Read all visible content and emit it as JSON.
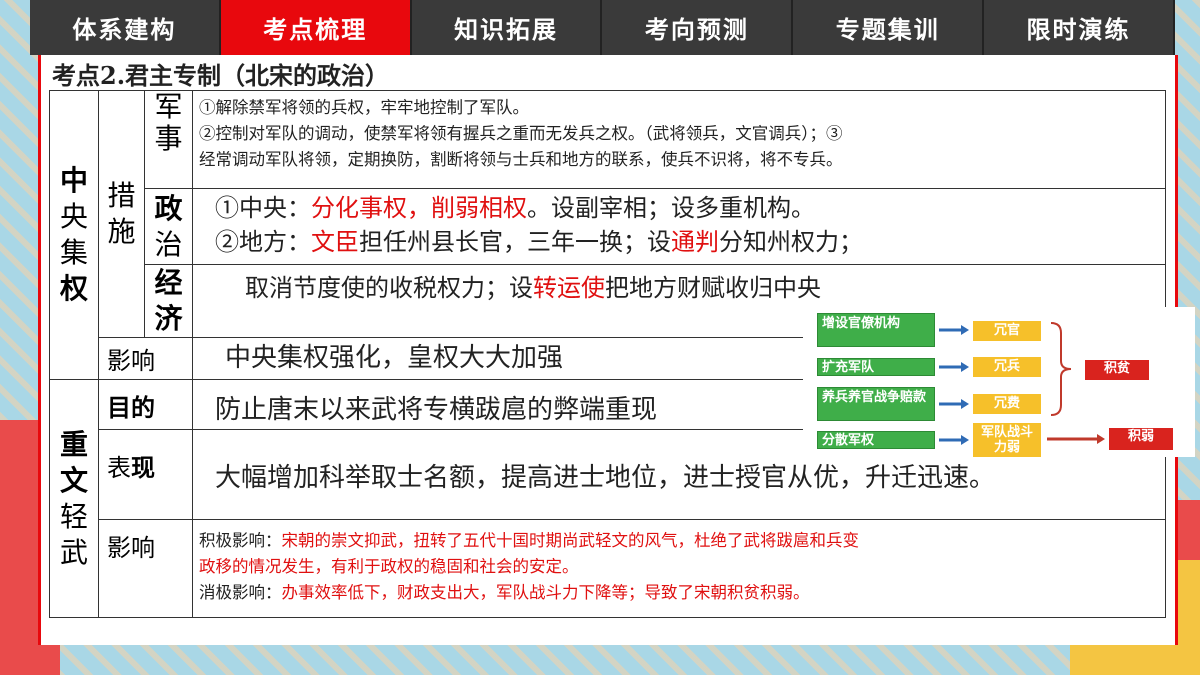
{
  "nav": {
    "tabs": [
      {
        "label": "体系建构",
        "active": false
      },
      {
        "label": "考点梳理",
        "active": true
      },
      {
        "label": "知识拓展",
        "active": false
      },
      {
        "label": "考向预测",
        "active": false
      },
      {
        "label": "专题集训",
        "active": false
      },
      {
        "label": "限时演练",
        "active": false
      }
    ]
  },
  "heading": "考点2.君主专制（北宋的政治）",
  "table": {
    "centralization": {
      "label_chars": [
        "中",
        "央",
        "集",
        "权"
      ],
      "measures_label_chars": [
        "措",
        "施"
      ],
      "military": {
        "label_chars": [
          "军",
          "事"
        ],
        "lines": [
          "①解除禁军将领的兵权，牢牢地控制了军队。",
          "②控制对军队的调动，使禁军将领有握兵之重而无发兵之权。（武将领兵，文官调兵）；③",
          "经常调动军队将领，定期换防，割断将领与士兵和地方的联系，使兵不识将，将不专兵。"
        ]
      },
      "politics": {
        "label_chars": [
          "政",
          "治"
        ],
        "line1": {
          "prefix": "①中央：",
          "red": "分化事权，削弱相权",
          "suffix": "。设副宰相；设多重机构。"
        },
        "line2": {
          "prefix": "②地方：",
          "red1": "文臣",
          "mid": "担任州县长官，三年一换；设",
          "red2": "通判",
          "suffix": "分知州权力；"
        }
      },
      "economy": {
        "label_chars": [
          "经",
          "济"
        ],
        "text_prefix": "取消节度使的收税权力；设",
        "text_red": "转运使",
        "text_suffix": "把地方财赋收归中央"
      },
      "impact": {
        "label": "影响",
        "text": "中央集权强化，皇权大大加强"
      }
    },
    "civil_over_military": {
      "label_chars": [
        "重",
        "文",
        "轻",
        "武"
      ],
      "purpose": {
        "label": "目的",
        "text": "防止唐末以来武将专横跋扈的弊端重现"
      },
      "manifestation": {
        "label_a": "表",
        "label_b": "现",
        "text": "大幅增加科举取士名额，提高进士地位，进士授官从优，升迁迅速。"
      },
      "impact": {
        "label": "影响",
        "positive_label": "积极影响：",
        "positive_text_1": "宋朝的崇文抑武，扭转了五代十国时期尚武轻文的风气，杜绝了武将跋扈和兵变",
        "positive_text_2": "政移的情况发生，有利于政权的稳固和社会的安定。",
        "negative_label": "消极影响：",
        "negative_text": "办事效率低下，财政支出大，军队战斗力下降等；导致了宋朝积贫积弱。"
      }
    }
  },
  "flowchart": {
    "causes": [
      "增设官僚机构",
      "扩充军队",
      "养兵养官战争赔款",
      "分散军权"
    ],
    "effects": [
      "冗官",
      "冗兵",
      "冗费",
      "军队战斗力弱"
    ],
    "results": [
      "积贫",
      "积弱"
    ],
    "colors": {
      "cause": "#3fae49",
      "effect": "#f6c02a",
      "result": "#d9231e",
      "arrow": "#2f6bb5"
    }
  }
}
